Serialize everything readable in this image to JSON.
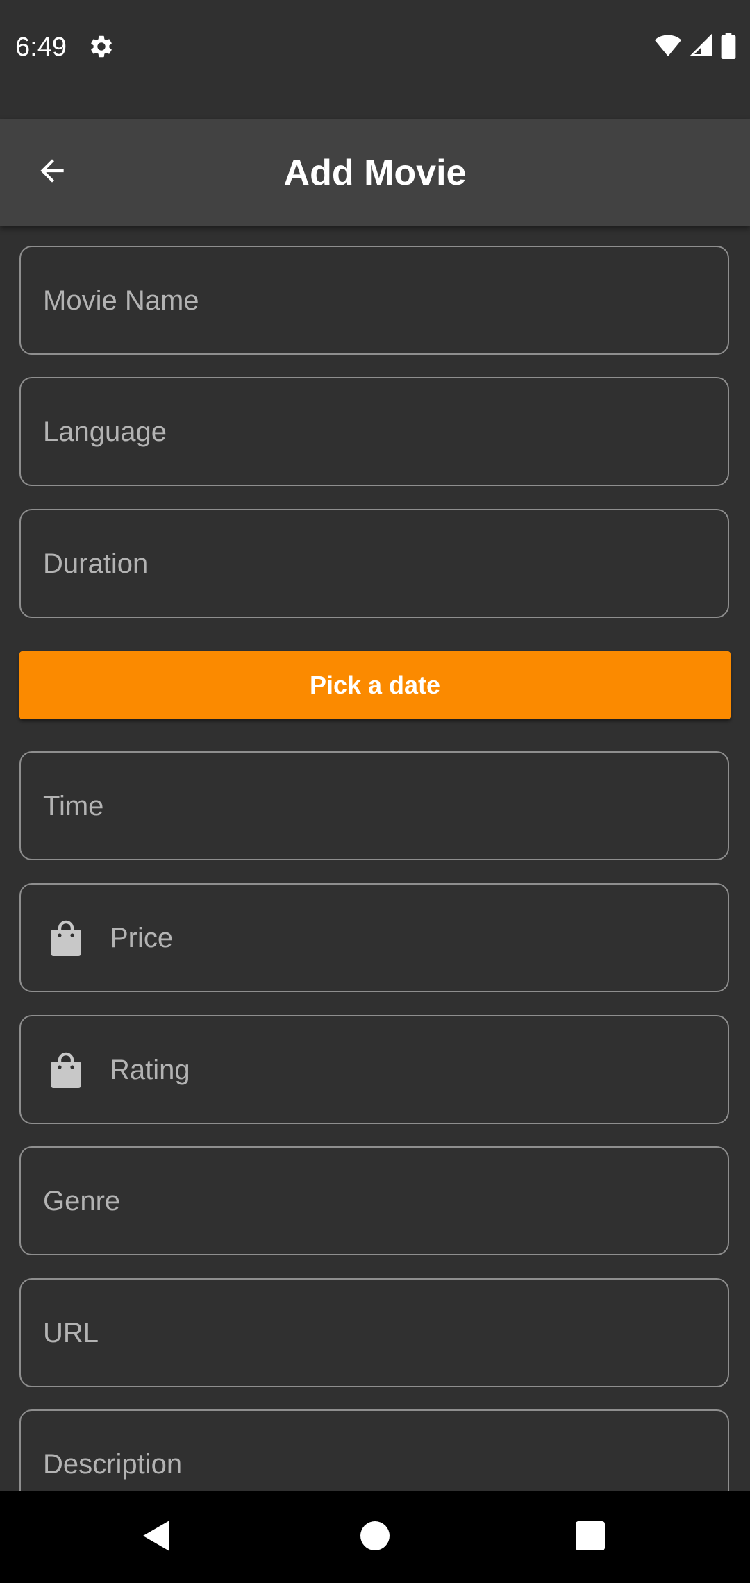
{
  "status_bar": {
    "time": "6:49",
    "icons": [
      "settings-gear-icon",
      "wifi-icon",
      "cellular-signal-icon",
      "battery-icon"
    ]
  },
  "app_bar": {
    "title": "Add Movie",
    "back_icon": "arrow-back-icon"
  },
  "form": {
    "fields": {
      "movie_name": {
        "placeholder": "Movie Name"
      },
      "language": {
        "placeholder": "Language"
      },
      "duration": {
        "placeholder": "Duration"
      },
      "time": {
        "placeholder": "Time"
      },
      "price": {
        "placeholder": "Price",
        "icon": "shopping-bag-icon"
      },
      "rating": {
        "placeholder": "Rating",
        "icon": "shopping-bag-icon"
      },
      "genre": {
        "placeholder": "Genre"
      },
      "url": {
        "placeholder": "URL"
      },
      "description": {
        "placeholder": "Description"
      }
    },
    "pick_date_label": "Pick a date"
  },
  "nav_bar": {
    "icons": [
      "nav-back-icon",
      "nav-home-icon",
      "nav-recents-icon"
    ]
  },
  "colors": {
    "background": "#303030",
    "app_bar": "#424242",
    "accent": "#fb8a00",
    "field_border": "#8e8e8e",
    "placeholder": "#b3b3b3"
  }
}
